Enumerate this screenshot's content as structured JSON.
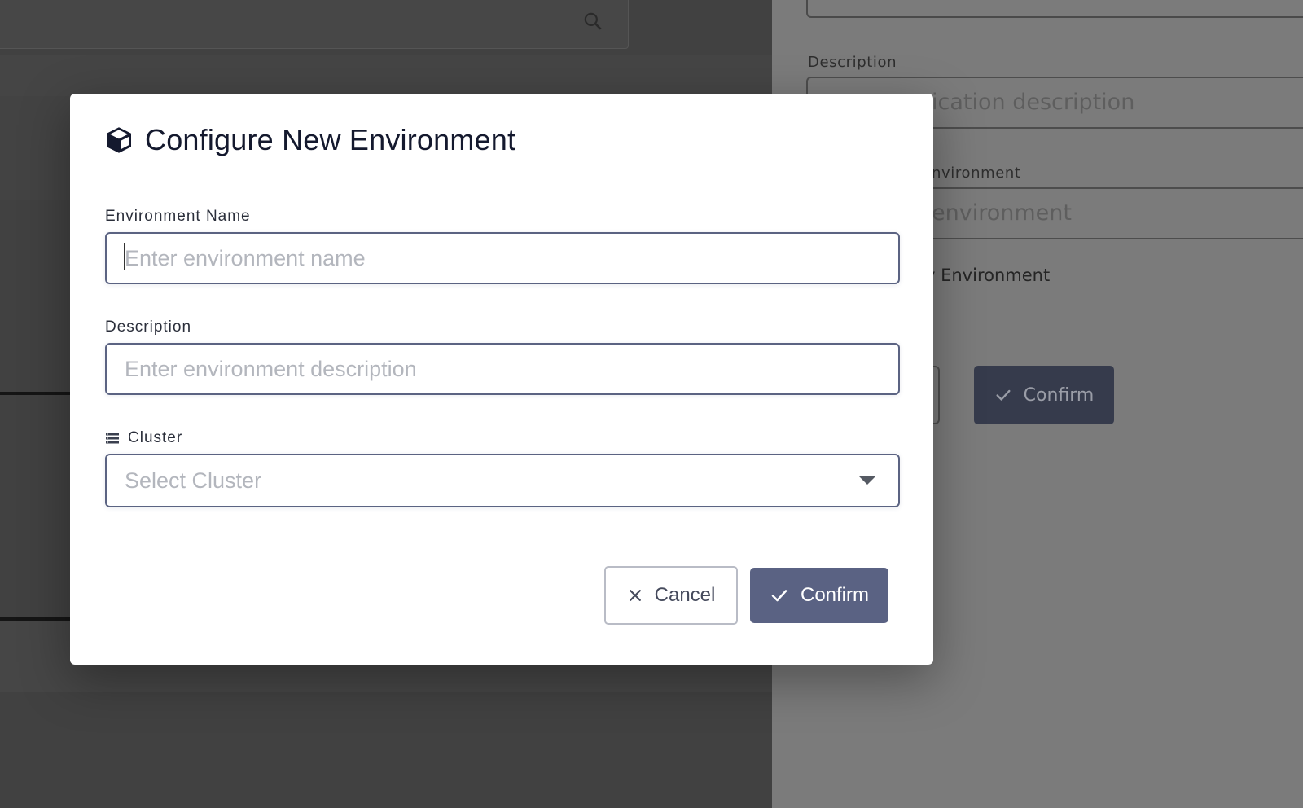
{
  "background": {
    "right_panel": {
      "description_label": "Description",
      "description_placeholder": "ication description",
      "environment_label": "nvironment",
      "environment_placeholder": "environment",
      "new_environment_text": "v Environment",
      "confirm_label": "Confirm"
    }
  },
  "modal": {
    "title": "Configure New Environment",
    "environment_name": {
      "label": "Environment Name",
      "placeholder": "Enter environment name",
      "value": ""
    },
    "description": {
      "label": "Description",
      "placeholder": "Enter environment description",
      "value": ""
    },
    "cluster": {
      "label": "Cluster",
      "placeholder": "Select Cluster"
    },
    "cancel_label": "Cancel",
    "confirm_label": "Confirm"
  },
  "colors": {
    "primary_button": "#5a6283",
    "title_text": "#14192e",
    "input_border": "#5b6382"
  }
}
